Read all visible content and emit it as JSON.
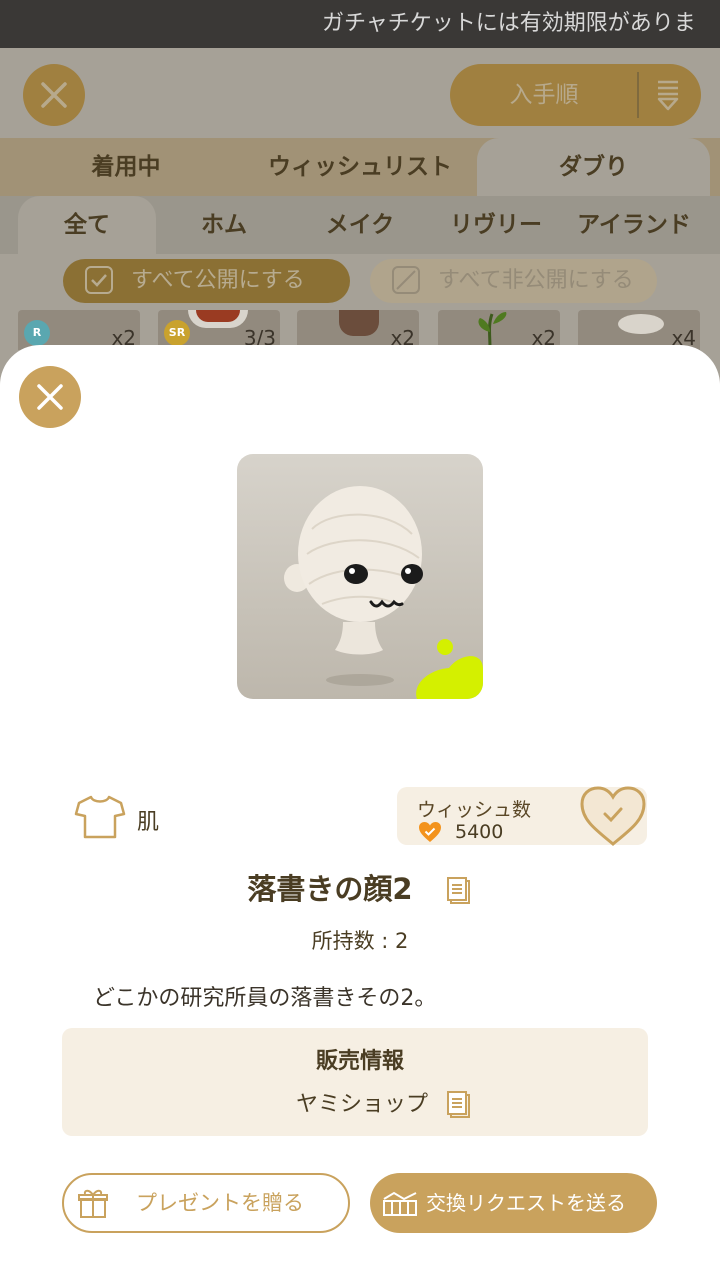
{
  "notice": {
    "text": "ガチャチケットには有効期限がありま"
  },
  "sort": {
    "label": "入手順"
  },
  "tabs_primary": [
    "着用中",
    "ウィッシュリスト",
    "ダブり"
  ],
  "tabs_primary_active": "ダブり",
  "tabs_secondary": [
    "全て",
    "ホム",
    "メイク",
    "リヴリー",
    "アイランド"
  ],
  "tabs_secondary_active": "全て",
  "bulk": {
    "public_label": "すべて公開にする",
    "private_label": "すべて非公開にする"
  },
  "items_row": [
    {
      "rarity": "R",
      "count": "x2"
    },
    {
      "rarity": "SR",
      "count": "3/3"
    },
    {
      "rarity": "",
      "count": "x2"
    },
    {
      "rarity": "",
      "count": "x2"
    },
    {
      "rarity": "",
      "count": "x4"
    }
  ],
  "detail": {
    "category": "肌",
    "wish_label": "ウィッシュ数",
    "wish_count": "5400",
    "name": "落書きの顔2",
    "owned": "所持数 : 2",
    "description": "どこかの研究所員の落書きその2。",
    "sale_title": "販売情報",
    "sale_shop": "ヤミショップ",
    "gift_label": "プレゼントを贈る",
    "trade_label": "交換リクエストを送る"
  },
  "colors": {
    "accent": "#c9a25d",
    "text": "#4a3d23",
    "panel": "#f6efe3",
    "neon": "#d4f000"
  }
}
